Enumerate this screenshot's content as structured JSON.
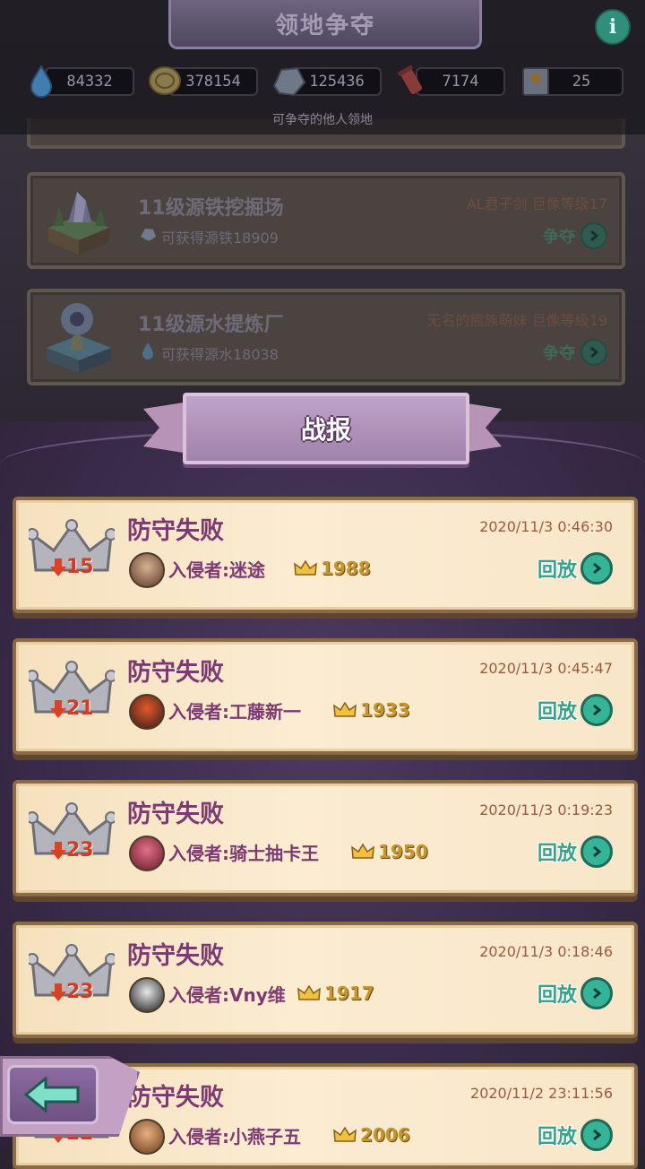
{
  "header": {
    "title": "领地争夺",
    "info_symbol": "i",
    "subtitle": "可争夺的他人领地"
  },
  "resources": [
    {
      "icon": "water-drop-icon",
      "value": "84332"
    },
    {
      "icon": "coin-icon",
      "value": "378154"
    },
    {
      "icon": "ore-icon",
      "value": "125436"
    },
    {
      "icon": "scroll-icon",
      "value": "7174"
    },
    {
      "icon": "ticket-icon",
      "value": "25"
    }
  ],
  "territories": [
    {
      "name": "11级源铁挖掘场",
      "reward": "可获得源铁18909",
      "owner": "AL君子剑  巨像等级17",
      "action": "争夺"
    },
    {
      "name": "11级源水提炼厂",
      "reward": "可获得源水18038",
      "owner": "无名的熊族萌妹  巨像等级19",
      "action": "争夺"
    }
  ],
  "battle_report": {
    "title": "战报",
    "items": [
      {
        "result": "防守失败",
        "time": "2020/11/3 0:46:30",
        "invader": "入侵者:迷途",
        "score": "1988",
        "rank_drop": "15",
        "replay": "回放"
      },
      {
        "result": "防守失败",
        "time": "2020/11/3 0:45:47",
        "invader": "入侵者:工藤新一",
        "score": "1933",
        "rank_drop": "21",
        "replay": "回放"
      },
      {
        "result": "防守失败",
        "time": "2020/11/3 0:19:23",
        "invader": "入侵者:骑士抽卡王",
        "score": "1950",
        "rank_drop": "23",
        "replay": "回放"
      },
      {
        "result": "防守失败",
        "time": "2020/11/3 0:18:46",
        "invader": "入侵者:Vny维",
        "score": "1917",
        "rank_drop": "23",
        "replay": "回放"
      },
      {
        "result": "防守失败",
        "time": "2020/11/2 23:11:56",
        "invader": "入侵者:小燕子五",
        "score": "2006",
        "rank_drop": "22",
        "replay": "回放"
      }
    ]
  },
  "colors": {
    "accent_green": "#35b597",
    "title_purple": "#7d3a72",
    "drop_red": "#d8381e",
    "gold": "#c7962a"
  }
}
